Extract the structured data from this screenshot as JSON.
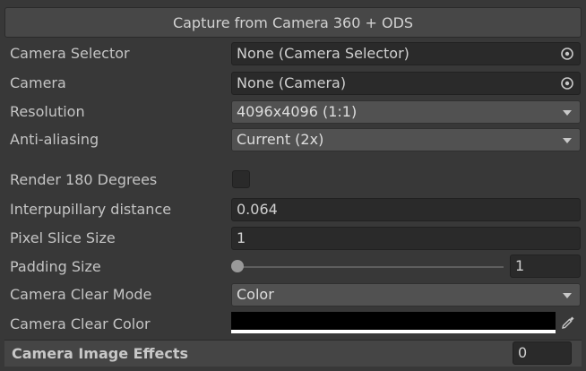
{
  "header": {
    "title": "Capture from Camera 360 + ODS"
  },
  "rows": {
    "camera_selector": {
      "label": "Camera Selector",
      "value": "None (Camera Selector)",
      "icon": "object-picker-icon"
    },
    "camera": {
      "label": "Camera",
      "value": "None (Camera)",
      "icon": "object-picker-icon"
    },
    "resolution": {
      "label": "Resolution",
      "value": "4096x4096 (1:1)"
    },
    "anti_aliasing": {
      "label": "Anti-aliasing",
      "value": "Current (2x)"
    },
    "render_180": {
      "label": "Render 180 Degrees",
      "checked": false
    },
    "ipd": {
      "label": "Interpupillary distance",
      "value": "0.064"
    },
    "pixel_slice": {
      "label": "Pixel Slice Size",
      "value": "1"
    },
    "padding": {
      "label": "Padding Size",
      "value": "1",
      "slider_fraction": 0.0
    },
    "clear_mode": {
      "label": "Camera Clear Mode",
      "value": "Color"
    },
    "clear_color": {
      "label": "Camera Clear Color",
      "color": "#000000",
      "icon": "eyedropper-icon"
    }
  },
  "footer": {
    "label": "Camera Image Effects",
    "value": "0"
  }
}
